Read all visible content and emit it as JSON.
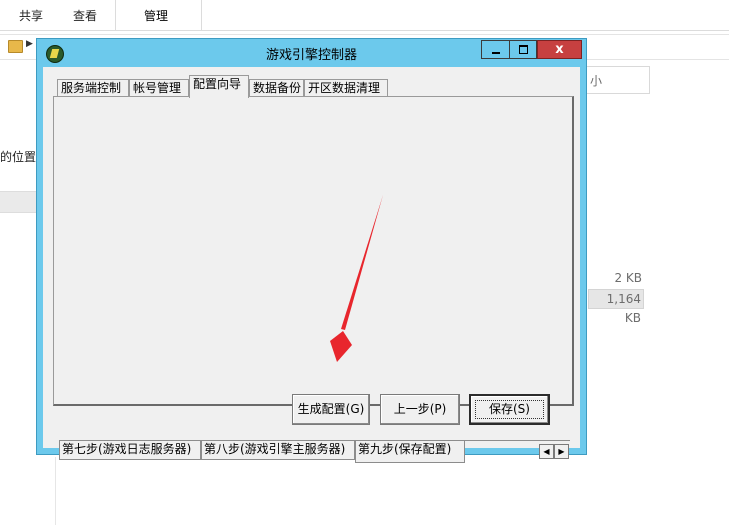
{
  "explorer": {
    "ribbon_tabs": [
      "共享",
      "查看",
      "管理"
    ],
    "search_placeholder": "小",
    "left_text": "的位置",
    "file_sizes": [
      "2 KB",
      "1,164 KB"
    ]
  },
  "dialog": {
    "title": "游戏引擎控制器",
    "close_label": "x",
    "tabs": [
      {
        "label": "服务端控制"
      },
      {
        "label": "帐号管理"
      },
      {
        "label": "配置向导",
        "active": true
      },
      {
        "label": "数据备份"
      },
      {
        "label": "开区数据清理"
      }
    ],
    "buttons": {
      "generate": "生成配置(G)",
      "previous": "上一步(P)",
      "save": "保存(S)"
    },
    "steps": [
      {
        "label": "第七步(游戏日志服务器)"
      },
      {
        "label": "第八步(游戏引擎主服务器)"
      },
      {
        "label": "第九步(保存配置)",
        "active": true
      }
    ]
  },
  "annotation": {
    "arrow_color": "#e8262d"
  }
}
